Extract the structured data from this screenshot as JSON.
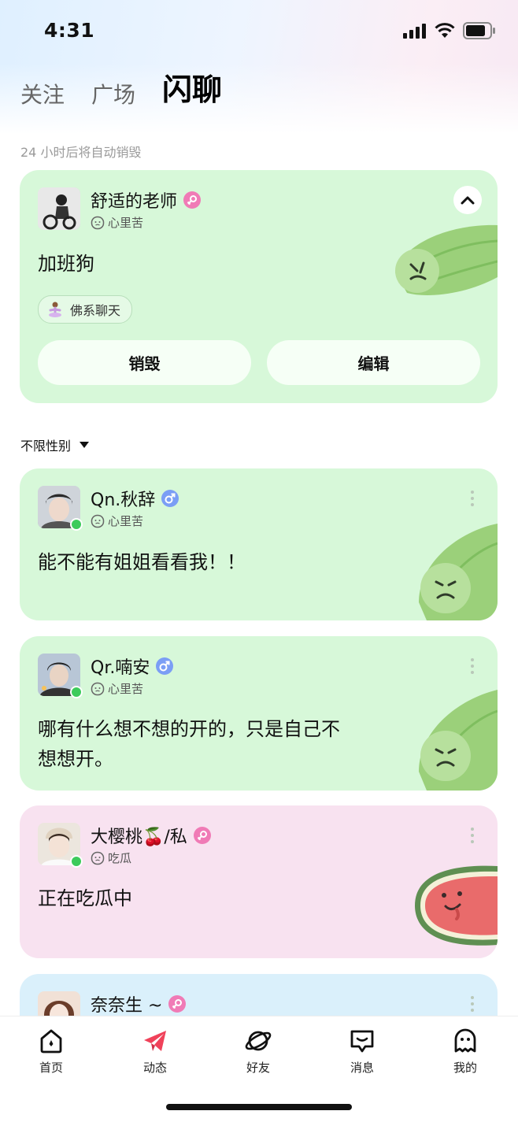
{
  "status_bar": {
    "time": "4:31"
  },
  "tabs": [
    {
      "label": "关注",
      "active": false
    },
    {
      "label": "广场",
      "active": false
    },
    {
      "label": "闪聊",
      "active": true
    }
  ],
  "hint": "24 小时后将自动销毁",
  "my_post": {
    "name": "舒适的老师",
    "gender": "female",
    "mood": "心里苦",
    "text": "加班狗",
    "tag": "佛系聊天",
    "destroy_label": "销毁",
    "edit_label": "编辑",
    "color": "#d7f8d9"
  },
  "filter": {
    "label": "不限性别"
  },
  "posts": [
    {
      "name": "Qn.秋辞",
      "gender": "male",
      "mood": "心里苦",
      "text": "能不能有姐姐看看我！！",
      "online": true,
      "color": "#d7f8d9"
    },
    {
      "name": "Qr.喃安",
      "gender": "male",
      "mood": "心里苦",
      "text_line1": "哪有什么想不想的开的，只是自己不",
      "text_line2": "想想开。",
      "online": true,
      "color": "#d7f8d9"
    },
    {
      "name": "大樱桃🍒/私",
      "gender": "female",
      "mood": "吃瓜",
      "text": "正在吃瓜中",
      "online": true,
      "color": "#f8e2f0"
    },
    {
      "name": "奈奈生 ~",
      "gender": "female",
      "online": false,
      "color": "#daf0fb"
    }
  ],
  "nav": [
    {
      "label": "首页",
      "icon": "home-icon"
    },
    {
      "label": "动态",
      "icon": "paper-plane-icon",
      "active": true
    },
    {
      "label": "好友",
      "icon": "planet-icon"
    },
    {
      "label": "消息",
      "icon": "message-icon"
    },
    {
      "label": "我的",
      "icon": "ghost-icon"
    }
  ],
  "colors": {
    "accent": "#f0425a",
    "female": "#f07bb6",
    "male": "#7b9ef5",
    "online": "#3ccb5b"
  }
}
